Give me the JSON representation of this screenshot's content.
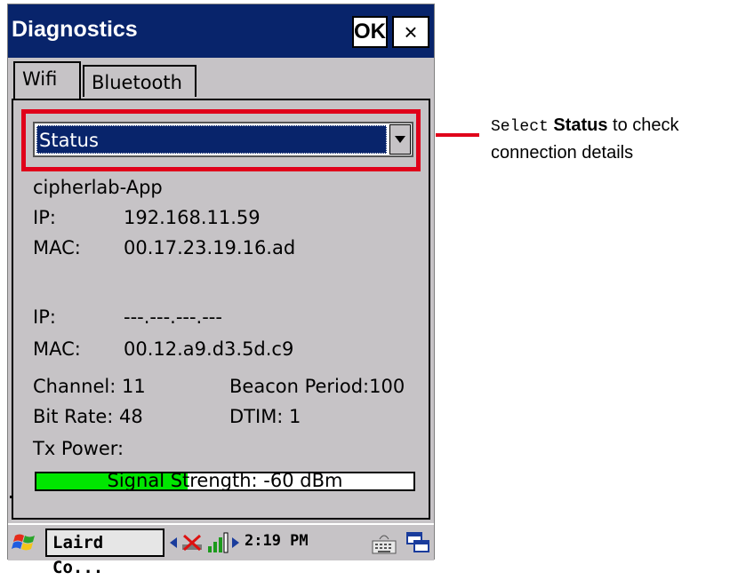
{
  "window": {
    "title": "Diagnostics",
    "ok_label": "OK",
    "close_label": "×"
  },
  "tabs": [
    {
      "label": "Wifi",
      "selected": true
    },
    {
      "label": "Bluetooth",
      "selected": false
    }
  ],
  "dropdown": {
    "selected": "Status"
  },
  "status": {
    "ssid": "cipherlab-App",
    "ip_label": "IP:",
    "ip_value": "192.168.11.59",
    "mac_label": "MAC:",
    "mac_value": "00.17.23.19.16.ad",
    "ip2_label": "IP:",
    "ip2_value": "---.---.---.---",
    "mac2_label": "MAC:",
    "mac2_value": "00.12.a9.d3.5d.c9",
    "channel": "Channel: 11",
    "beacon": "Beacon Period:100",
    "bitrate": "Bit Rate: 48",
    "dtim": "DTIM: 1",
    "txpower": "Tx Power:"
  },
  "signal": {
    "text": "Signal Strength: -60 dBm",
    "level": 0.4,
    "fill_color": "#00e600"
  },
  "taskbar": {
    "task_label": "Laird Co...",
    "time": "2:19 PM",
    "icons": [
      "windows-flag-icon",
      "network-disconnected-icon",
      "signal-bars-icon",
      "keyboard-icon",
      "windows-switch-icon"
    ]
  },
  "callout": {
    "prefix": "Select",
    "bold": "Status",
    "suffix": " to check",
    "line2": "connection details"
  },
  "colors": {
    "title_bg": "#08246b",
    "highlight": "#e0001a",
    "window_bg": "#c6c3c6"
  }
}
